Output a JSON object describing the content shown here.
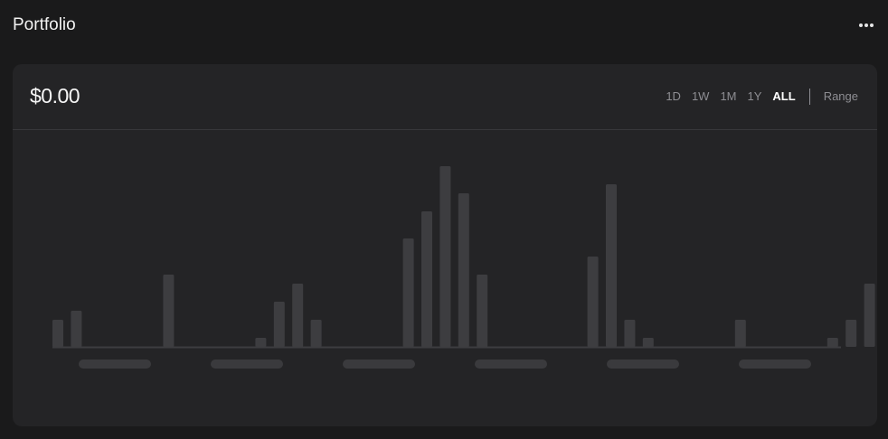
{
  "header": {
    "title": "Portfolio",
    "more_icon": "more-horizontal-icon"
  },
  "card": {
    "balance": "$0.00",
    "range_tabs": [
      "1D",
      "1W",
      "1M",
      "1Y",
      "ALL"
    ],
    "active_range": "ALL",
    "range_link": "Range"
  },
  "colors": {
    "background": "#1a1a1b",
    "card": "#242426",
    "bar": "#3d3d40",
    "placeholder": "#3a3a3d",
    "active_tab": "#ffffff",
    "inactive_tab": "#8e8e93"
  },
  "chart_data": {
    "type": "bar",
    "state": "loading-placeholder",
    "values": [
      3,
      4,
      0,
      0,
      0,
      0,
      8,
      0,
      0,
      0,
      0,
      1,
      5,
      7,
      3,
      0,
      0,
      0,
      0,
      12,
      15,
      20,
      17,
      8,
      0,
      0,
      0,
      0,
      0,
      10,
      18,
      3,
      1,
      0,
      0,
      0,
      0,
      3,
      0,
      0,
      0,
      0,
      1,
      3,
      7
    ],
    "ylim": [
      0,
      20
    ],
    "x_label_placeholders": 6,
    "grid": false,
    "legend": "none"
  }
}
